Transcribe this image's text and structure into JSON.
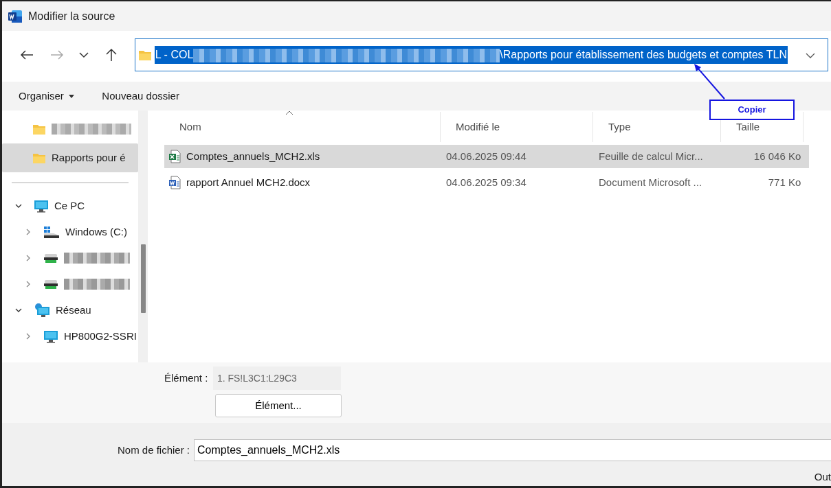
{
  "window": {
    "title": "Modifier la source"
  },
  "nav": {
    "back_disabled": false,
    "forward_disabled": true
  },
  "address": {
    "path_start": "L - COL",
    "path_end": "\\Rapports pour établissement des budgets et comptes TLN",
    "selected": true
  },
  "annotation": {
    "label": "Copier"
  },
  "toolbar": {
    "organize": "Organiser",
    "new_folder": "Nouveau dossier"
  },
  "quick_access": [
    {
      "kind": "redacted",
      "selected": false
    },
    {
      "kind": "item",
      "label": "Rapports pour é",
      "selected": true
    }
  ],
  "tree": [
    {
      "kind": "computer",
      "label": "Ce PC",
      "expanded": true,
      "children": [
        {
          "kind": "system-drive",
          "label": "Windows (C:)",
          "expanded": false
        },
        {
          "kind": "drive",
          "expanded": false
        },
        {
          "kind": "drive",
          "expanded": false
        }
      ]
    },
    {
      "kind": "network",
      "label": "Réseau",
      "expanded": true,
      "children": [
        {
          "kind": "computer",
          "label": "HP800G2-SSRI",
          "expanded": false
        }
      ]
    }
  ],
  "table": {
    "columns": [
      "Nom",
      "Modifié le",
      "Type",
      "Taille"
    ],
    "rows": [
      {
        "kind": "xls",
        "name": "Comptes_annuels_MCH2.xls",
        "modified": "04.06.2025 09:44",
        "type": "Feuille de calcul Micr...",
        "size": "16 046 Ko",
        "selected": true
      },
      {
        "kind": "docx",
        "name": "rapport Annuel MCH2.docx",
        "modified": "04.06.2025 09:34",
        "type": "Document Microsoft ...",
        "size": "771 Ko",
        "selected": false
      }
    ]
  },
  "element": {
    "label": "Élément :",
    "value": "1. FS!L3C1:L29C3",
    "disabled": true,
    "button": "Élément..."
  },
  "filename": {
    "label": "Nom de fichier :",
    "value": "Comptes_annuels_MCH2.xls"
  },
  "footer_button": "Out"
}
